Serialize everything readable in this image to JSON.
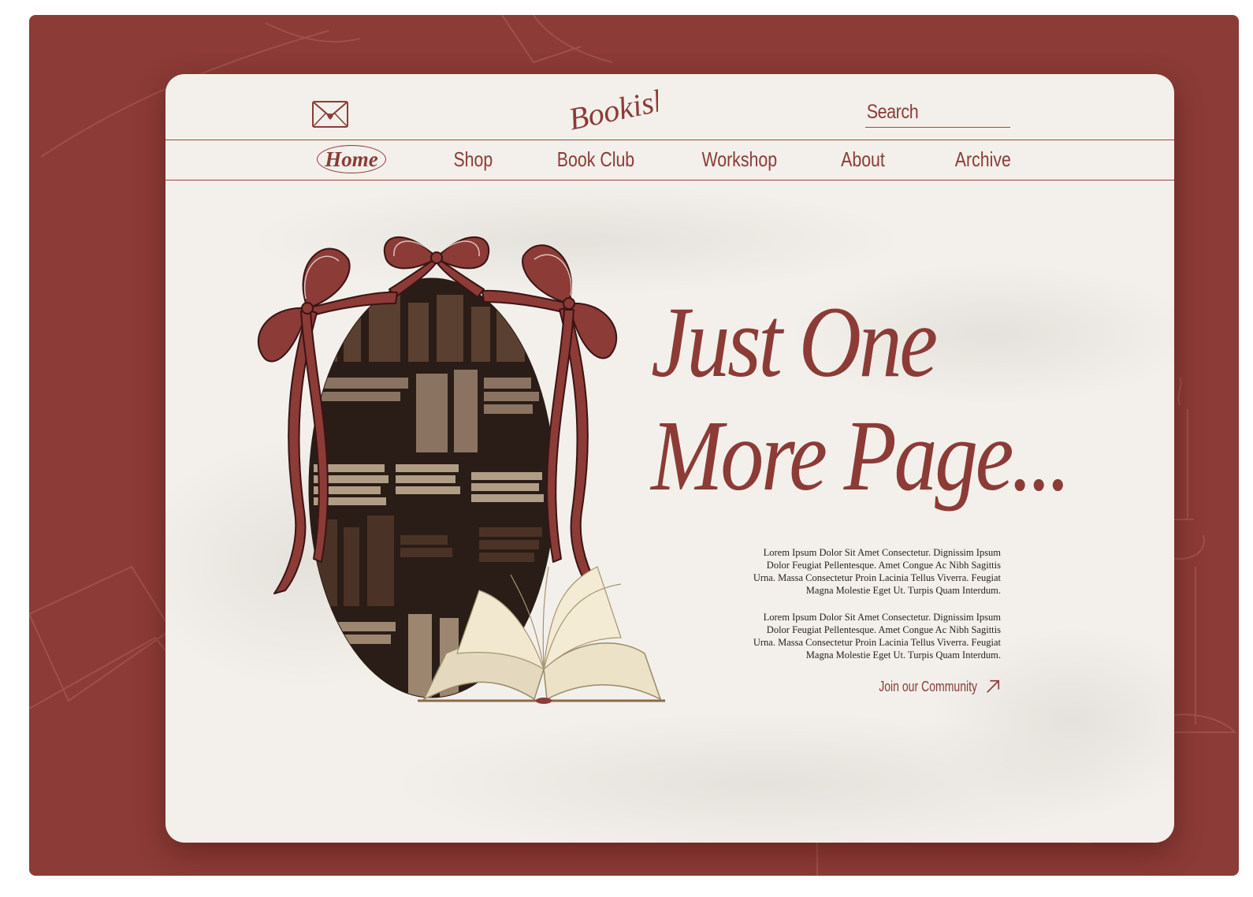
{
  "colors": {
    "brand": "#8c3b36",
    "backdrop": "#8c3b36",
    "paper": "#f3f0eb",
    "body_text": "#2b201d",
    "page_bg": "#ffffff"
  },
  "header": {
    "mail_icon": "envelope-heart-icon",
    "logo_text": "Bookish",
    "search": {
      "placeholder": "Search",
      "value": ""
    }
  },
  "nav": {
    "active": "Home",
    "items": [
      {
        "label": "Home"
      },
      {
        "label": "Shop"
      },
      {
        "label": "Book Club"
      },
      {
        "label": "Workshop"
      },
      {
        "label": "About"
      },
      {
        "label": "Archive"
      }
    ]
  },
  "hero": {
    "title_line1": "Just One",
    "title_line2": "More Page...",
    "paragraphs": [
      "Lorem Ipsum Dolor Sit Amet Consectetur. Dignissim Ipsum Dolor Feugiat Pellentesque. Amet Congue Ac Nibh Sagittis Urna. Massa Consectetur Proin Lacinia Tellus Viverra. Feugiat Magna Molestie Eget Ut. Turpis Quam Interdum.",
      "Lorem Ipsum Dolor Sit Amet Consectetur. Dignissim Ipsum Dolor Feugiat Pellentesque. Amet Congue Ac Nibh Sagittis Urna. Massa Consectetur Proin Lacinia Tellus Viverra. Feugiat Magna Molestie Eget Ut. Turpis Quam Interdum."
    ],
    "cta_label": "Join our Community",
    "cta_icon": "arrow-up-right-icon",
    "art_icons": [
      "ribbon-bow-icon",
      "bookshelf-oval-image",
      "open-book-icon"
    ]
  }
}
